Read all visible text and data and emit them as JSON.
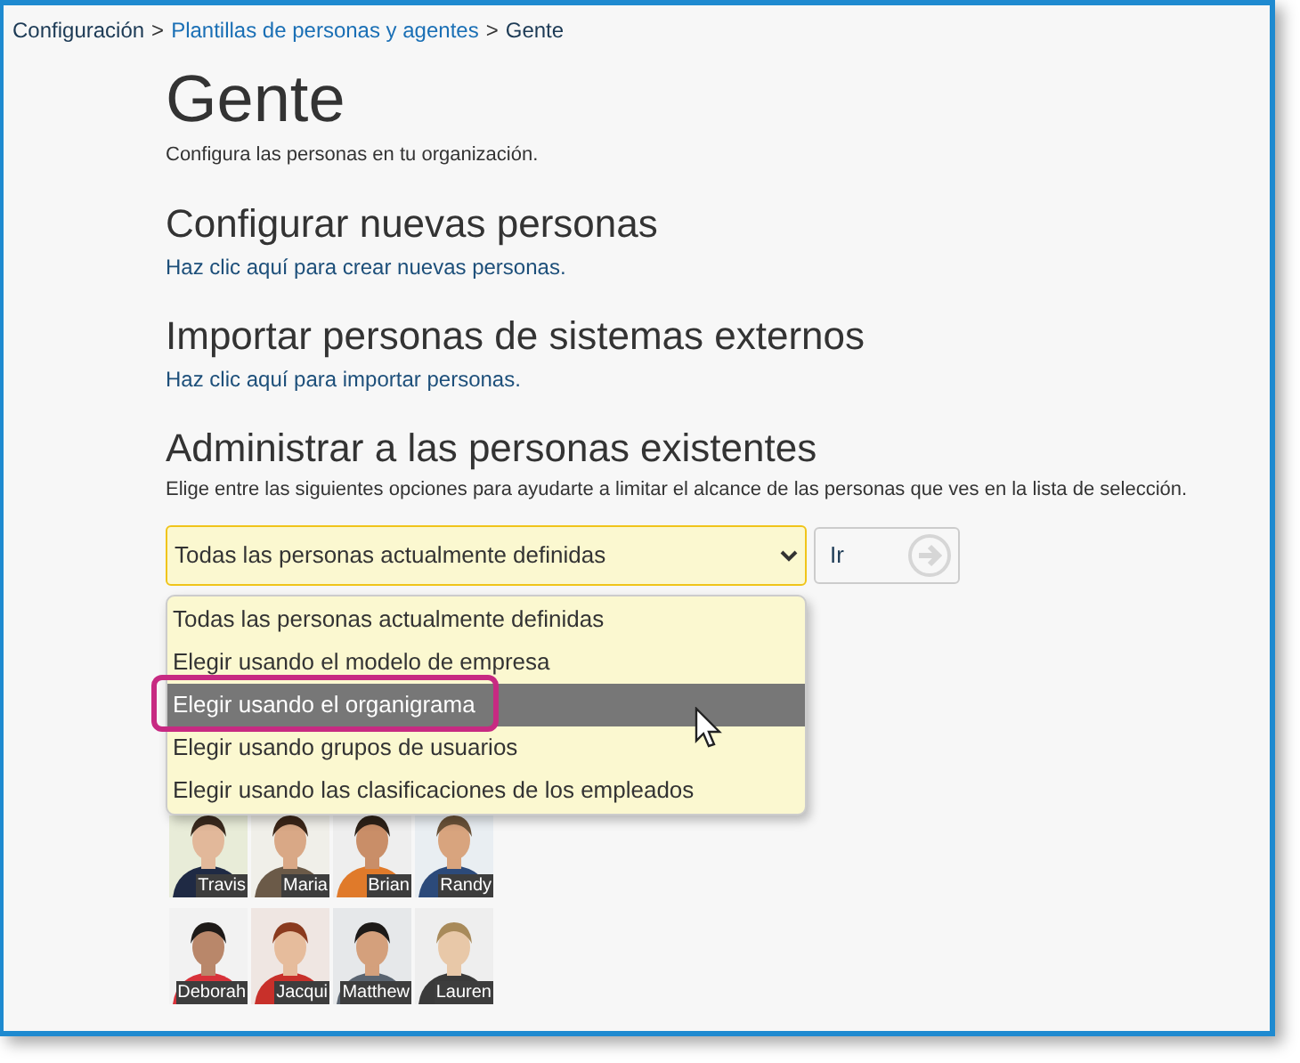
{
  "breadcrumb": [
    {
      "label": "Configuración",
      "link": false
    },
    {
      "label": "Plantillas de personas y agentes",
      "link": true
    },
    {
      "label": "Gente",
      "link": false
    }
  ],
  "separator": ">",
  "title": "Gente",
  "subtitle": "Configura las personas en tu organización.",
  "sections": [
    {
      "heading": "Configurar nuevas personas",
      "text": "Haz clic aquí para crear nuevas personas."
    },
    {
      "heading": "Importar personas de sistemas externos",
      "text": "Haz clic aquí para importar personas."
    }
  ],
  "manage": {
    "heading": "Administrar a las personas existentes",
    "description": "Elige entre las siguientes opciones para ayudarte a limitar el alcance de las personas que ves en la lista de selección.",
    "select": {
      "value": "Todas las personas actualmente definidas",
      "expanded": true,
      "options": [
        {
          "label": "Todas las personas actualmente definidas",
          "hovered": false,
          "highlighted": false
        },
        {
          "label": "Elegir usando el modelo de empresa",
          "hovered": false,
          "highlighted": false
        },
        {
          "label": "Elegir usando el organigrama",
          "hovered": true,
          "highlighted": true
        },
        {
          "label": "Elegir usando grupos de usuarios",
          "hovered": false,
          "highlighted": false
        },
        {
          "label": "Elegir usando las clasificaciones de los empleados",
          "hovered": false,
          "highlighted": false
        }
      ]
    },
    "go_button": "Ir"
  },
  "people": [
    {
      "name": "Travis"
    },
    {
      "name": "Maria"
    },
    {
      "name": "Brian"
    },
    {
      "name": "Randy"
    },
    {
      "name": "Deborah"
    },
    {
      "name": "Jacqui"
    },
    {
      "name": "Matthew"
    },
    {
      "name": "Lauren"
    }
  ]
}
